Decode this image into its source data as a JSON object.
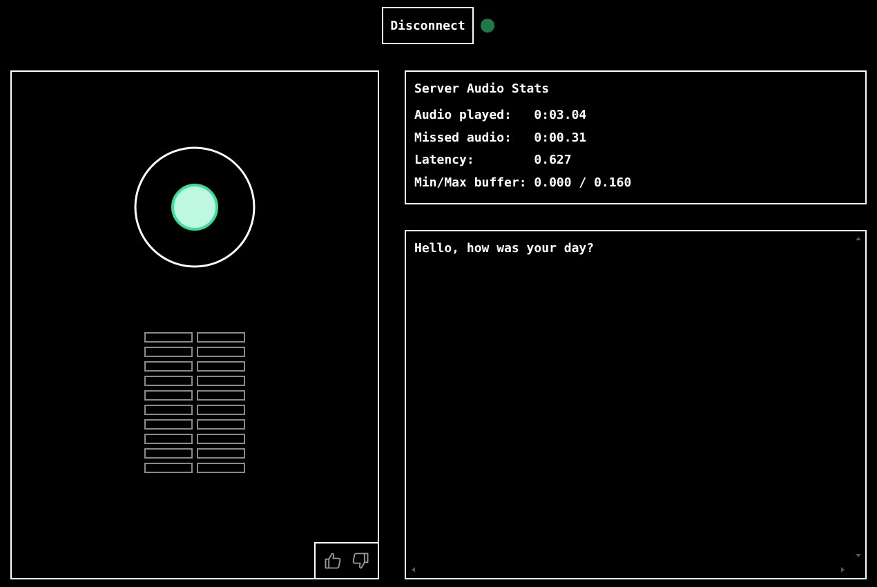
{
  "header": {
    "disconnect_label": "Disconnect",
    "status_color": "#1e7b45"
  },
  "visualizer": {
    "ring_color": "#ffffff",
    "orb_fill": "#bff8e2",
    "orb_stroke": "#3ddc97",
    "meter_cell_color": "#8a8a8a",
    "meter_rows": 10,
    "meter_columns": 2
  },
  "feedback": {
    "thumbs_up_icon": "thumbs-up-icon",
    "thumbs_down_icon": "thumbs-down-icon"
  },
  "stats": {
    "title": "Server Audio Stats",
    "rows": [
      {
        "label": "Audio played:  ",
        "value": " 0:03.04"
      },
      {
        "label": "Missed audio:  ",
        "value": " 0:00.31"
      },
      {
        "label": "Latency:       ",
        "value": " 0.627"
      },
      {
        "label": "Min/Max buffer:",
        "value": " 0.000 / 0.160"
      }
    ]
  },
  "transcript": {
    "text": "Hello, how was your day?"
  }
}
